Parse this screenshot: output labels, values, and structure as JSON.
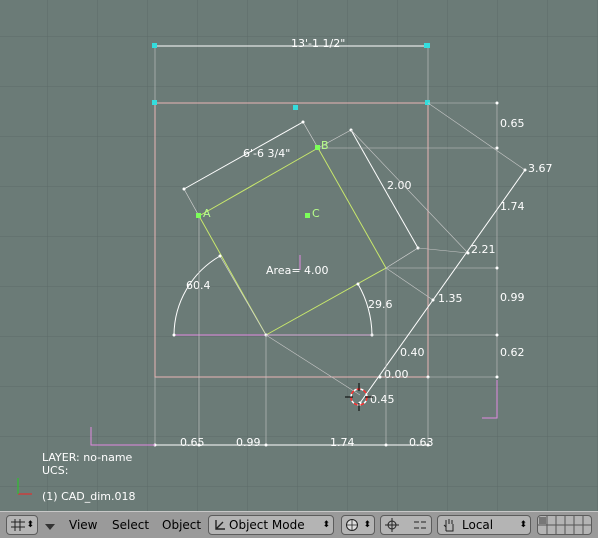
{
  "viewport": {
    "dimensions": {
      "total_width": "13'-1 1/2\"",
      "diag": "6'-6 3/4\"",
      "side": "2.00",
      "bottom": [
        "0.65",
        "0.99",
        "1.74",
        "0.63"
      ],
      "right": [
        "0.65",
        "0.99",
        "0.62"
      ],
      "diag_chain": [
        "3.67",
        "1.74",
        "2.21",
        "1.35",
        "0.40",
        "0.00",
        "0.45"
      ],
      "angles": [
        "60.4",
        "29.6"
      ],
      "area": "Area= 4.00"
    },
    "points": {
      "a": "A",
      "b": "B",
      "c": "C"
    },
    "info": {
      "layer": "LAYER: no-name",
      "ucs": "UCS:",
      "object": "(1) CAD_dim.018"
    }
  },
  "header": {
    "menu_view": "View",
    "menu_select": "Select",
    "menu_object": "Object",
    "mode": "Object Mode",
    "orientation": "Local"
  }
}
